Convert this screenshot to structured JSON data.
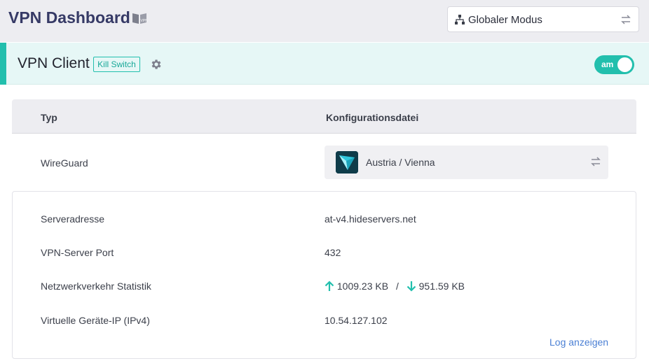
{
  "header": {
    "title": "VPN Dashboard",
    "mode_label": "Globaler Modus",
    "icons": [
      "book-vpn-icon",
      "network-icon",
      "swap-icon"
    ]
  },
  "client": {
    "title": "VPN Client",
    "kill_switch_label": "Kill Switch",
    "toggle_label": "am",
    "toggle_on": true,
    "accent_color": "#22bfad"
  },
  "table": {
    "col_type": "Typ",
    "col_config": "Konfigurationsdatei",
    "type_value": "WireGuard",
    "config_value": "Austria / Vienna"
  },
  "details": {
    "server_label": "Serveradresse",
    "server_value": "at-v4.hideservers.net",
    "port_label": "VPN-Server Port",
    "port_value": "432",
    "traffic_label": "Netzwerkverkehr Statistik",
    "upload_value": "1009.23 KB",
    "traffic_separator": "/",
    "download_value": "951.59 KB",
    "ip_label": "Virtuelle Geräte-IP (IPv4)",
    "ip_value": "10.54.127.102",
    "log_link": "Log anzeigen"
  }
}
